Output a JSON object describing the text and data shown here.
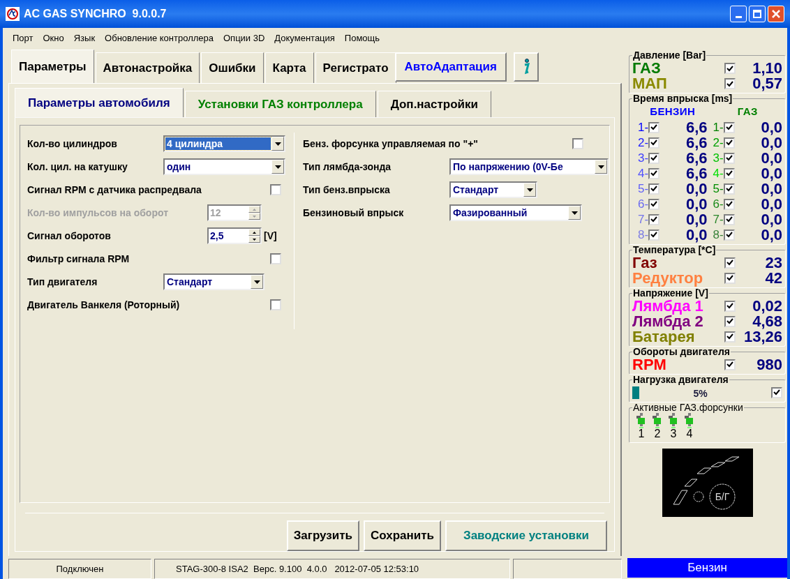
{
  "window": {
    "title": "AC GAS SYNCHRO  9.0.0.7"
  },
  "menu": [
    "Порт",
    "Окно",
    "Язык",
    "Обновление контроллера",
    "Опции 3D",
    "Документация",
    "Помощь"
  ],
  "main_tabs": [
    {
      "label": "Параметры",
      "selected": true
    },
    {
      "label": "Автонастройка",
      "selected": false
    },
    {
      "label": "Ошибки",
      "selected": false
    },
    {
      "label": "Карта",
      "selected": false
    },
    {
      "label": "Регистрато",
      "selected": false
    }
  ],
  "auto_adapt_button": "АвтоАдаптация",
  "sub_tabs": [
    {
      "label": "Параметры автомобиля",
      "selected": true,
      "color": "#000080"
    },
    {
      "label": "Установки ГАЗ контроллера",
      "selected": false,
      "color": "#008000"
    },
    {
      "label": "Доп.настройки",
      "selected": false,
      "color": "#000000"
    }
  ],
  "left_settings": [
    {
      "kind": "select",
      "label": "Кол-во цилиндров",
      "value": "4 цилиндра",
      "focused": true
    },
    {
      "kind": "select",
      "label": "Кол. цил. на катушку",
      "value": "один",
      "focused": false
    },
    {
      "kind": "checkbox",
      "label": "Сигнал RPM с датчика распредвала",
      "checked": false
    },
    {
      "kind": "spin",
      "label": "Кол-во импульсов на оборот",
      "value": "12",
      "disabled": true
    },
    {
      "kind": "spin",
      "label": "Сигнал оборотов",
      "value": "2,5",
      "disabled": false,
      "unit": "[V]"
    },
    {
      "kind": "checkbox",
      "label": "Фильтр сигнала RPM",
      "checked": false
    },
    {
      "kind": "select",
      "label": "Тип двигателя",
      "value": "Стандарт",
      "focused": false
    },
    {
      "kind": "checkbox",
      "label": "Двигатель Ванкеля (Роторный)",
      "checked": false
    }
  ],
  "right_settings": [
    {
      "kind": "checkbox",
      "label": "Бенз. форсунка управляемая по \"+\"",
      "checked": false
    },
    {
      "kind": "select",
      "label": "Тип лямбда-зонда",
      "value": "По напряжению (0V-Бе",
      "focused": false
    },
    {
      "kind": "select",
      "label": "Тип бенз.впрыска",
      "value": "Стандарт",
      "focused": false
    },
    {
      "kind": "select",
      "label": "Бензиновый впрыск",
      "value": "Фазированный",
      "focused": false
    }
  ],
  "buttons": [
    {
      "label": "Загрузить",
      "color": "#000000"
    },
    {
      "label": "Сохранить",
      "color": "#000000"
    },
    {
      "label": "Заводские установки",
      "color": "#008080"
    }
  ],
  "status_bar": [
    "Подключен",
    "STAG-300-8 ISA2  Верс. 9.100  4.0.0   2012-07-05 12:53:10"
  ],
  "pressure": {
    "title": "Давление [Bar]",
    "rows": [
      {
        "label": "ГАЗ",
        "color": "#007a00",
        "checked": true,
        "value": "1,10"
      },
      {
        "label": "МАП",
        "color": "#8a8a00",
        "checked": true,
        "value": "0,57"
      }
    ]
  },
  "injection": {
    "title": "Время впрыска [ms]",
    "columns": [
      {
        "title": "БЕНЗИН",
        "color": "#0000ff",
        "rows": [
          {
            "label": "1-",
            "color": "#0000ff",
            "checked": true,
            "value": "6,6"
          },
          {
            "label": "2-",
            "color": "#2020ff",
            "checked": true,
            "value": "6,6"
          },
          {
            "label": "3-",
            "color": "#4040ff",
            "checked": true,
            "value": "6,6"
          },
          {
            "label": "4-",
            "color": "#5050ff",
            "checked": true,
            "value": "6,6"
          },
          {
            "label": "5-",
            "color": "#6060f8",
            "checked": true,
            "value": "0,0"
          },
          {
            "label": "6-",
            "color": "#6a6af0",
            "checked": true,
            "value": "0,0"
          },
          {
            "label": "7-",
            "color": "#7474ea",
            "checked": true,
            "value": "0,0"
          },
          {
            "label": "8-",
            "color": "#7c7ce4",
            "checked": true,
            "value": "0,0"
          }
        ]
      },
      {
        "title": "ГАЗ",
        "color": "#008000",
        "rows": [
          {
            "label": "1-",
            "color": "#008000",
            "checked": true,
            "value": "0,0"
          },
          {
            "label": "2-",
            "color": "#00a000",
            "checked": true,
            "value": "0,0"
          },
          {
            "label": "3-",
            "color": "#00c000",
            "checked": true,
            "value": "0,0"
          },
          {
            "label": "4-",
            "color": "#00e000",
            "checked": true,
            "value": "0,0"
          },
          {
            "label": "5-",
            "color": "#008c00",
            "checked": true,
            "value": "0,0"
          },
          {
            "label": "6-",
            "color": "#1a8a1a",
            "checked": true,
            "value": "0,0"
          },
          {
            "label": "7-",
            "color": "#2a862a",
            "checked": true,
            "value": "0,0"
          },
          {
            "label": "8-",
            "color": "#3a823a",
            "checked": true,
            "value": "0,0"
          }
        ]
      }
    ]
  },
  "temperature": {
    "title": "Температура  [*C]",
    "rows": [
      {
        "label": "Газ",
        "color": "#800000",
        "checked": true,
        "value": "23"
      },
      {
        "label": "Редуктор",
        "color": "#ff8040",
        "checked": true,
        "value": "42"
      }
    ]
  },
  "voltage": {
    "title": "Напряжение [V]",
    "rows": [
      {
        "label": "Лямбда 1",
        "color": "#ff00ff",
        "checked": true,
        "value": "0,02"
      },
      {
        "label": "Лямбда 2",
        "color": "#800080",
        "checked": true,
        "value": "4,68"
      },
      {
        "label": "Батарея",
        "color": "#808000",
        "checked": true,
        "value": "13,26"
      }
    ]
  },
  "rpm": {
    "title": "Обороты двигателя",
    "rows": [
      {
        "label": "RPM",
        "color": "#ff0000",
        "checked": true,
        "value": "980"
      }
    ]
  },
  "load": {
    "title": "Нагрузка двигателя",
    "level": 0.05,
    "reading": "5%",
    "checked": true
  },
  "injectors": {
    "title": "Активные ГАЗ.форсунки",
    "items": [
      {
        "label": "1",
        "on": true
      },
      {
        "label": "2",
        "on": true
      },
      {
        "label": "3",
        "on": true
      },
      {
        "label": "4",
        "on": true
      }
    ]
  },
  "switch": {
    "label": "Б/Г"
  },
  "fuel_status": "Бензин"
}
